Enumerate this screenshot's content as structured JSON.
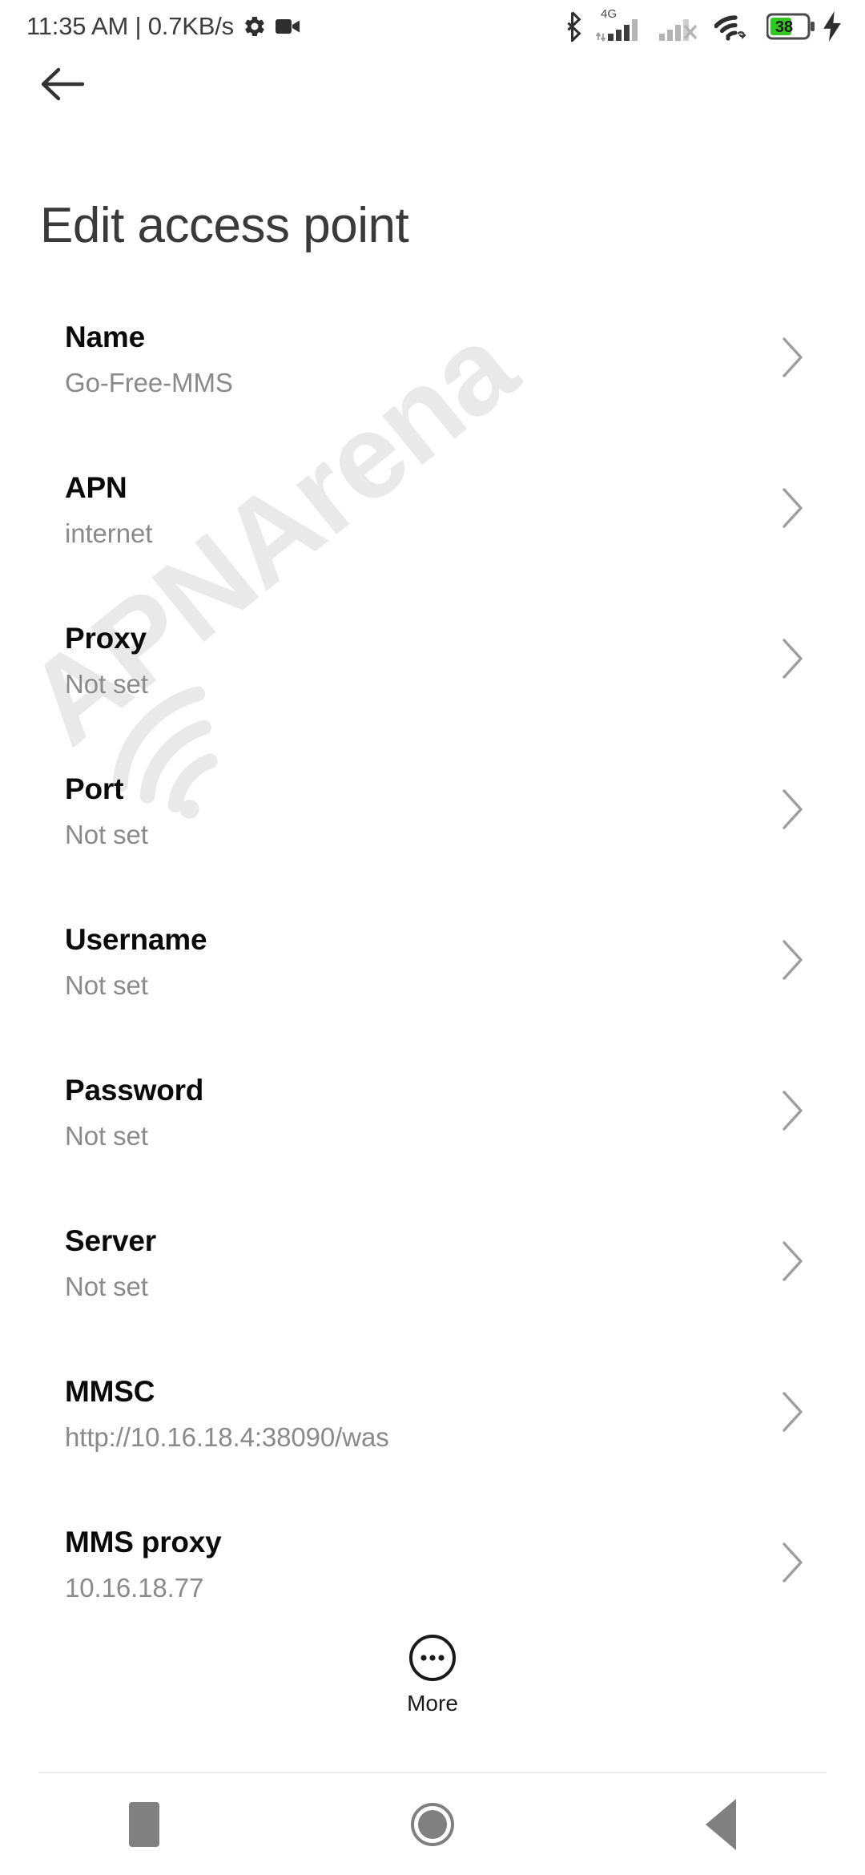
{
  "status_bar": {
    "time": "11:35 AM",
    "separator": "|",
    "network_speed": "0.7KB/s",
    "combined_left_text": "11:35 AM | 0.7KB/s",
    "icons_left": [
      "gear-icon",
      "video-camera-icon"
    ],
    "icons_right": [
      "bluetooth-icon",
      "sim1-signal-icon",
      "sim2-signal-no-service-icon",
      "wifi-vpn-icon",
      "battery-icon",
      "charging-bolt-icon"
    ],
    "sim1_network_type": "4G",
    "battery_level": "38",
    "battery_fill_color": "#34c724",
    "charging": true
  },
  "app_bar": {
    "back_label": "Back",
    "title": "Edit access point"
  },
  "watermark": {
    "text": "APNArena",
    "color": "#e9e9e9"
  },
  "list": {
    "rows": [
      {
        "label": "Name",
        "value": "Go-Free-MMS"
      },
      {
        "label": "APN",
        "value": "internet"
      },
      {
        "label": "Proxy",
        "value": "Not set"
      },
      {
        "label": "Port",
        "value": "Not set"
      },
      {
        "label": "Username",
        "value": "Not set"
      },
      {
        "label": "Password",
        "value": "Not set"
      },
      {
        "label": "Server",
        "value": "Not set"
      },
      {
        "label": "MMSC",
        "value": "http://10.16.18.4:38090/was"
      },
      {
        "label": "MMS proxy",
        "value": "10.16.18.77"
      }
    ]
  },
  "more_button": {
    "label": "More",
    "icon": "ellipsis-circle-icon"
  },
  "nav_bar": {
    "recents_label": "Recents",
    "home_label": "Home",
    "back_label": "Back"
  },
  "colors": {
    "background": "#ffffff",
    "label_text": "#0a0a0a",
    "value_text": "#8a8a8a",
    "title_text": "#3a3a3a",
    "chevron": "#9e9e9e",
    "nav_icon": "#808080",
    "divider": "#e4e4e4"
  }
}
